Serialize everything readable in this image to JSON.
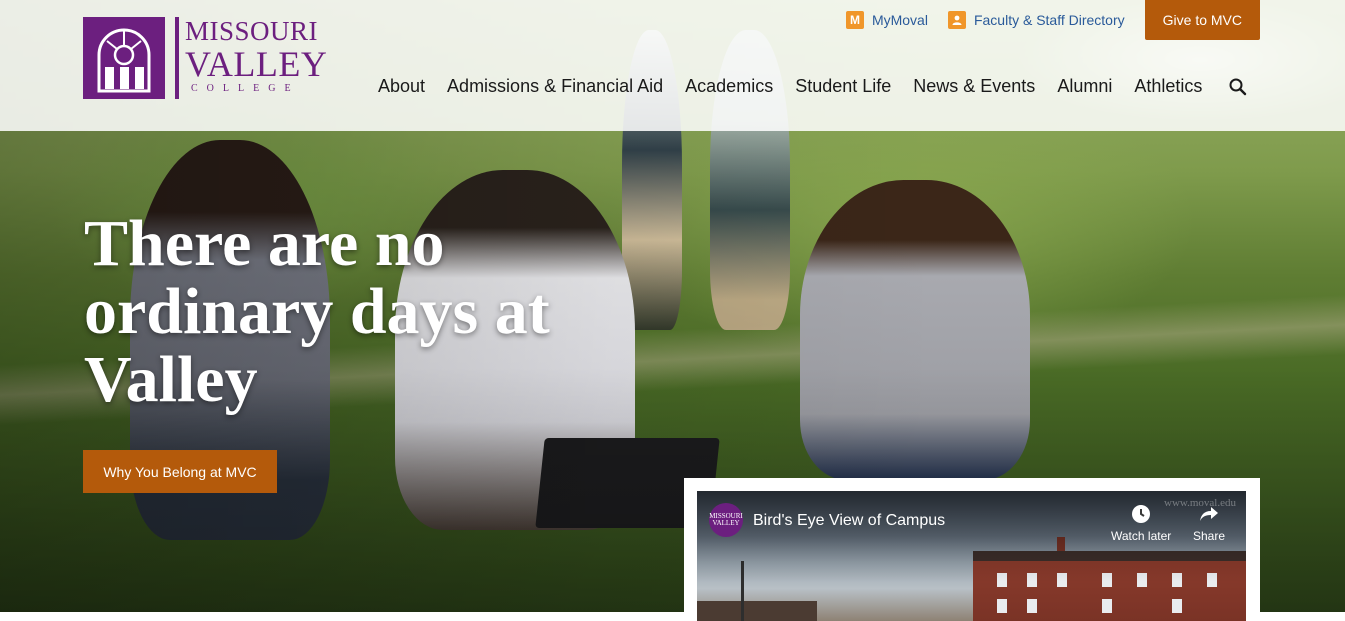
{
  "header": {
    "logo": {
      "line1": "MISSOURI",
      "line2": "VALLEY",
      "line3": "COLLEGE"
    },
    "utility": {
      "mymoval_icon_letter": "M",
      "mymoval": "MyMoval",
      "directory": "Faculty & Staff Directory",
      "give": "Give to MVC"
    },
    "nav": [
      "About",
      "Admissions & Financial Aid",
      "Academics",
      "Student Life",
      "News & Events",
      "Alumni",
      "Athletics"
    ],
    "search_icon": "search-icon"
  },
  "hero": {
    "headline": "There are no ordinary days at Valley",
    "cta": "Why You Belong at MVC"
  },
  "video": {
    "channel_logo_line1": "MISSOURI",
    "channel_logo_line2": "VALLEY",
    "title": "Bird's Eye View of Campus",
    "watch_later": "Watch later",
    "share": "Share",
    "watermark": "www.moval.edu"
  },
  "colors": {
    "brand_purple": "#6c1f7f",
    "accent_orange": "#b45a0b",
    "link_blue": "#2a5a9a"
  }
}
